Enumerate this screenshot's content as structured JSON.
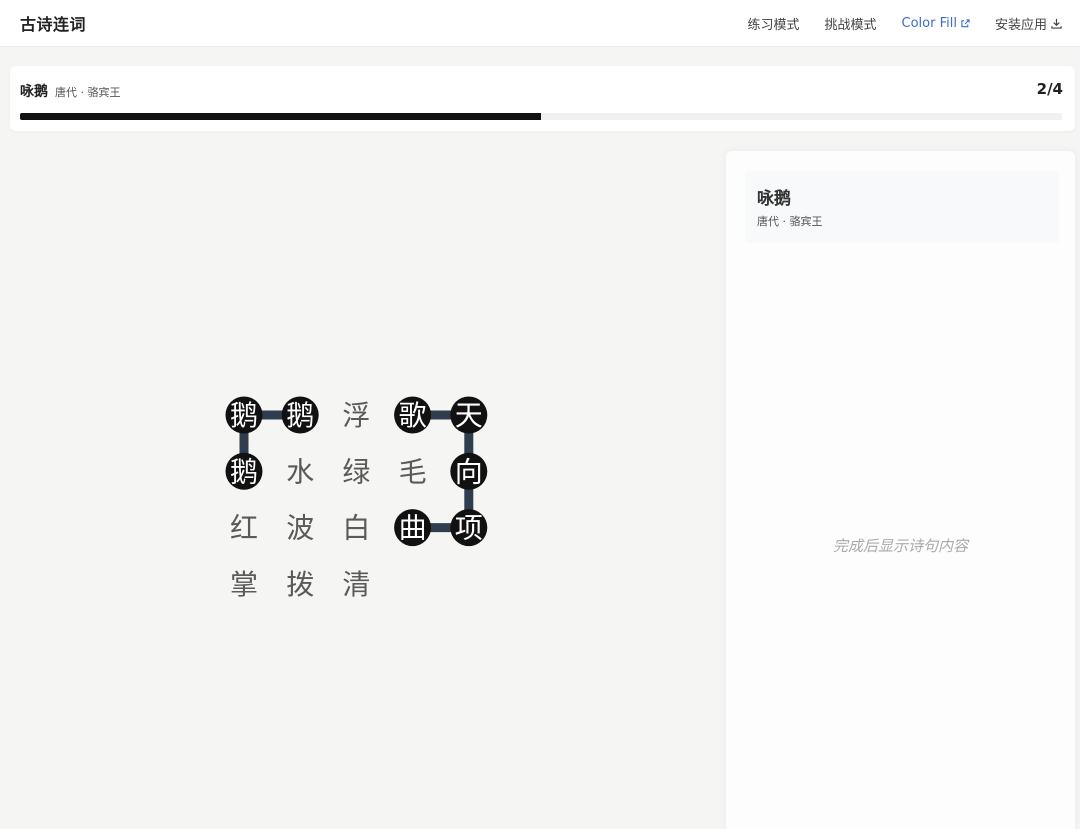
{
  "header": {
    "app_title": "古诗连词",
    "nav": {
      "practice": "练习模式",
      "challenge": "挑战模式",
      "color_fill": "Color Fill",
      "install": "安装应用"
    }
  },
  "progress": {
    "poem_title": "咏鹅",
    "poem_meta": "唐代 · 骆宾王",
    "count": "2/4",
    "fraction": 0.5
  },
  "board": {
    "rows": [
      [
        {
          "c": "鹅",
          "sel": true
        },
        {
          "c": "鹅",
          "sel": true
        },
        {
          "c": "浮",
          "sel": false
        },
        {
          "c": "歌",
          "sel": true
        },
        {
          "c": "天",
          "sel": true
        }
      ],
      [
        {
          "c": "鹅",
          "sel": true
        },
        {
          "c": "水",
          "sel": false
        },
        {
          "c": "绿",
          "sel": false
        },
        {
          "c": "毛",
          "sel": false
        },
        {
          "c": "向",
          "sel": true
        }
      ],
      [
        {
          "c": "红",
          "sel": false
        },
        {
          "c": "波",
          "sel": false
        },
        {
          "c": "白",
          "sel": false
        },
        {
          "c": "曲",
          "sel": true
        },
        {
          "c": "项",
          "sel": true
        }
      ],
      [
        {
          "c": "掌",
          "sel": false
        },
        {
          "c": "拨",
          "sel": false
        },
        {
          "c": "清",
          "sel": false
        },
        {
          "c": "",
          "sel": false
        },
        {
          "c": "",
          "sel": false
        }
      ]
    ],
    "paths": [
      [
        [
          1,
          0
        ],
        [
          0,
          0
        ],
        [
          0,
          1
        ]
      ],
      [
        [
          0,
          3
        ],
        [
          0,
          4
        ],
        [
          1,
          4
        ],
        [
          2,
          4
        ],
        [
          2,
          3
        ]
      ]
    ],
    "colors": {
      "line": "#2f3e4e",
      "selected_bg": "#111111",
      "selected_text": "#ffffff",
      "idle_text": "#5a5a5a"
    }
  },
  "side": {
    "poem_title": "咏鹅",
    "poem_meta": "唐代 · 骆宾王",
    "placeholder": "完成后显示诗句内容"
  }
}
